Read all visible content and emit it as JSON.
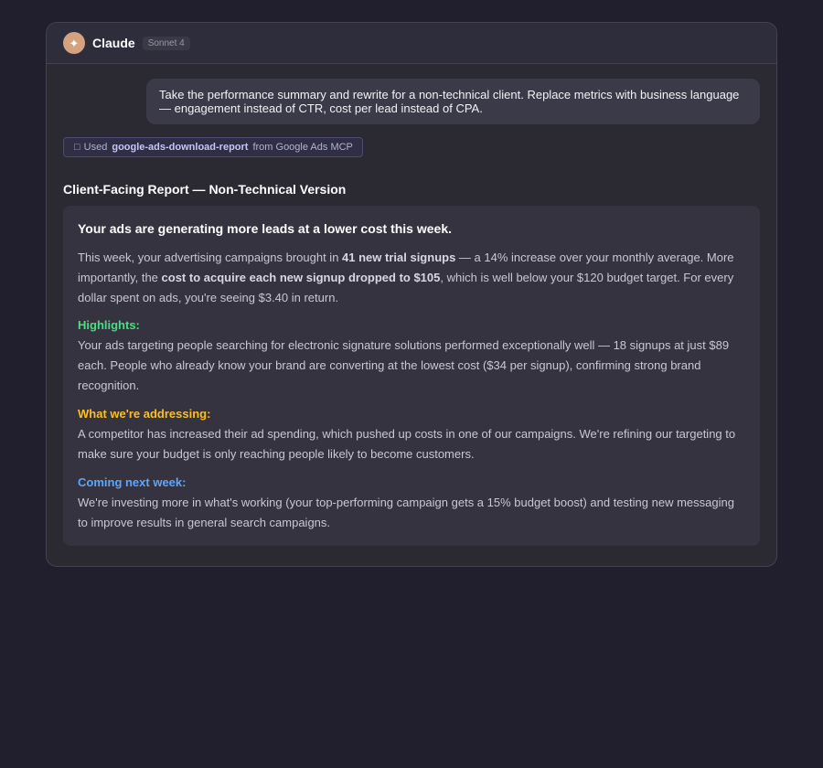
{
  "header": {
    "avatar_glyph": "✦",
    "app_name": "Claude",
    "model": "Sonnet 4"
  },
  "user_message": "Take the performance summary and rewrite for a non-technical client. Replace metrics with business language — engagement instead of CTR, cost per lead instead of CPA.",
  "tool_use": {
    "icon": "□",
    "prefix": "Used",
    "tool_name": "google-ads-download-report",
    "suffix": "from Google Ads MCP"
  },
  "response": {
    "section_title": "Client-Facing Report — Non-Technical Version",
    "headline": "Your ads are generating more leads at a lower cost this week.",
    "intro": {
      "t1": "This week, your advertising campaigns brought in ",
      "b1": "41 new trial signups",
      "t2": " — a 14% increase over your monthly average. More importantly, the ",
      "b2": "cost to acquire each new signup dropped to $105",
      "t3": ", which is well below your $120 budget target. For every dollar spent on ads, you're seeing $3.40 in return."
    },
    "highlights": {
      "heading": "Highlights:",
      "text": "Your ads targeting people searching for electronic signature solutions performed exceptionally well — 18 signups at just $89 each. People who already know your brand are converting at the lowest cost ($34 per signup), confirming strong brand recognition."
    },
    "addressing": {
      "heading": "What we're addressing:",
      "text": "A competitor has increased their ad spending, which pushed up costs in one of our campaigns. We're refining our targeting to make sure your budget is only reaching people likely to become customers."
    },
    "next_week": {
      "heading": "Coming next week:",
      "text": "We're investing more in what's working (your top-performing campaign gets a 15% budget boost) and testing new messaging to improve results in general search campaigns."
    }
  },
  "colors": {
    "highlights": "#4ade80",
    "addressing": "#fbbf24",
    "next_week": "#60a5fa",
    "avatar": "#d4a27f"
  }
}
